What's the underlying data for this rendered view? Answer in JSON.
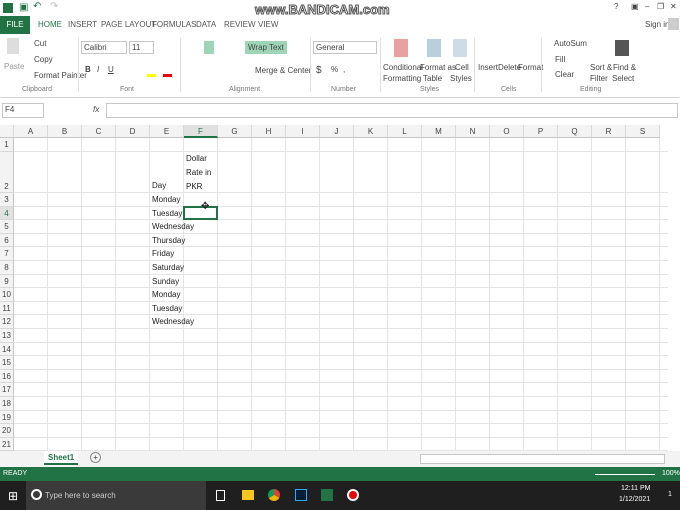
{
  "window": {
    "watermark": "www.BANDICAM.com",
    "help": "?",
    "minimize": "–",
    "restore": "❐",
    "close": "✕",
    "sign_in": "Sign in"
  },
  "tabs": [
    "FILE",
    "HOME",
    "INSERT",
    "PAGE LAYOUT",
    "FORMULAS",
    "DATA",
    "REVIEW",
    "VIEW"
  ],
  "active_tab": "HOME",
  "ribbon": {
    "clipboard": {
      "paste": "Paste",
      "cut": "Cut",
      "copy": "Copy",
      "format_painter": "Format Painter",
      "label": "Clipboard"
    },
    "font": {
      "name": "Calibri",
      "size": "11",
      "bold": "B",
      "italic": "I",
      "underline": "U",
      "label": "Font"
    },
    "alignment": {
      "wrap_text": "Wrap Text",
      "merge_center": "Merge & Center",
      "label": "Alignment"
    },
    "number": {
      "format": "General",
      "currency": "$",
      "percent": "%",
      "comma": ",",
      "label": "Number"
    },
    "styles": {
      "conditional": [
        "Conditional",
        "Formatting"
      ],
      "format_table": [
        "Format as",
        "Table"
      ],
      "cell_styles": [
        "Cell",
        "Styles"
      ],
      "label": "Styles"
    },
    "cells": {
      "insert": "Insert",
      "delete": "Delete",
      "format": "Format",
      "label": "Cells"
    },
    "editing": {
      "autosum": "AutoSum",
      "fill": "Fill",
      "clear": "Clear",
      "sort": [
        "Sort &",
        "Filter"
      ],
      "find": [
        "Find &",
        "Select"
      ],
      "label": "Editing"
    }
  },
  "formula_bar": {
    "name_box": "F4",
    "fx": "fx",
    "value": ""
  },
  "columns": [
    "A",
    "B",
    "C",
    "D",
    "E",
    "F",
    "G",
    "H",
    "I",
    "J",
    "K",
    "L",
    "M",
    "N",
    "O",
    "P",
    "Q",
    "R",
    "S"
  ],
  "rows": [
    "1",
    "2",
    "3",
    "4",
    "5",
    "6",
    "7",
    "8",
    "9",
    "10",
    "11",
    "12",
    "13",
    "14",
    "15",
    "16",
    "17",
    "18",
    "19",
    "20",
    "21"
  ],
  "cells": {
    "E2": "Day",
    "F2": [
      "Dollar",
      "Rate in",
      "PKR"
    ],
    "E": [
      "Monday",
      "Tuesday",
      "Wednesday",
      "Thursday",
      "Friday",
      "Saturday",
      "Sunday",
      "Monday",
      "Tuesday",
      "Wednesday"
    ]
  },
  "selected_cell": "F4",
  "sheets": [
    "Sheet1"
  ],
  "status": {
    "mode": "READY",
    "zoom": "100%"
  },
  "taskbar": {
    "search_placeholder": "Type here to search",
    "time": "12:11 PM",
    "date": "1/12/2021",
    "notifications": "1"
  },
  "colors": {
    "excel_green": "#217346",
    "selection": "#217346"
  }
}
